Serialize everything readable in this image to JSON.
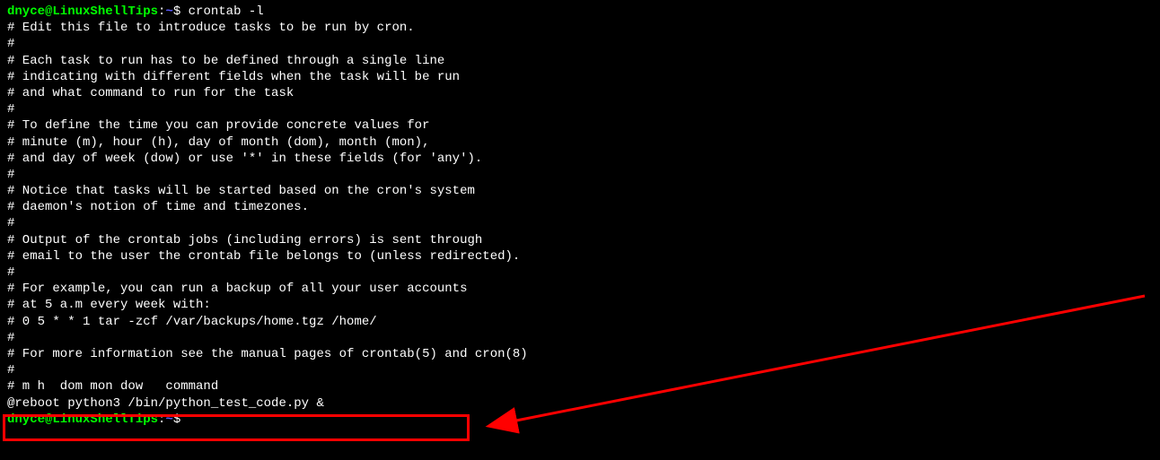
{
  "prompt1": {
    "user": "dnyce@LinuxShellTips",
    "colon": ":",
    "path": "~",
    "dollar": "$ ",
    "command": "crontab -l"
  },
  "output": {
    "line1": "# Edit this file to introduce tasks to be run by cron.",
    "line2": "#",
    "line3": "# Each task to run has to be defined through a single line",
    "line4": "# indicating with different fields when the task will be run",
    "line5": "# and what command to run for the task",
    "line6": "#",
    "line7": "# To define the time you can provide concrete values for",
    "line8": "# minute (m), hour (h), day of month (dom), month (mon),",
    "line9": "# and day of week (dow) or use '*' in these fields (for 'any').",
    "line10": "#",
    "line11": "# Notice that tasks will be started based on the cron's system",
    "line12": "# daemon's notion of time and timezones.",
    "line13": "#",
    "line14": "# Output of the crontab jobs (including errors) is sent through",
    "line15": "# email to the user the crontab file belongs to (unless redirected).",
    "line16": "#",
    "line17": "# For example, you can run a backup of all your user accounts",
    "line18": "# at 5 a.m every week with:",
    "line19": "# 0 5 * * 1 tar -zcf /var/backups/home.tgz /home/",
    "line20": "#",
    "line21": "# For more information see the manual pages of crontab(5) and cron(8)",
    "line22": "#",
    "line23": "# m h  dom mon dow   command",
    "line24": "",
    "line25": "@reboot python3 /bin/python_test_code.py &",
    "line26": ""
  },
  "prompt2": {
    "user": "dnyce@LinuxShellTips",
    "colon": ":",
    "path": "~",
    "dollar": "$ "
  },
  "annotation": {
    "highlight_color": "#ff0000",
    "arrow_color": "#ff0000"
  }
}
